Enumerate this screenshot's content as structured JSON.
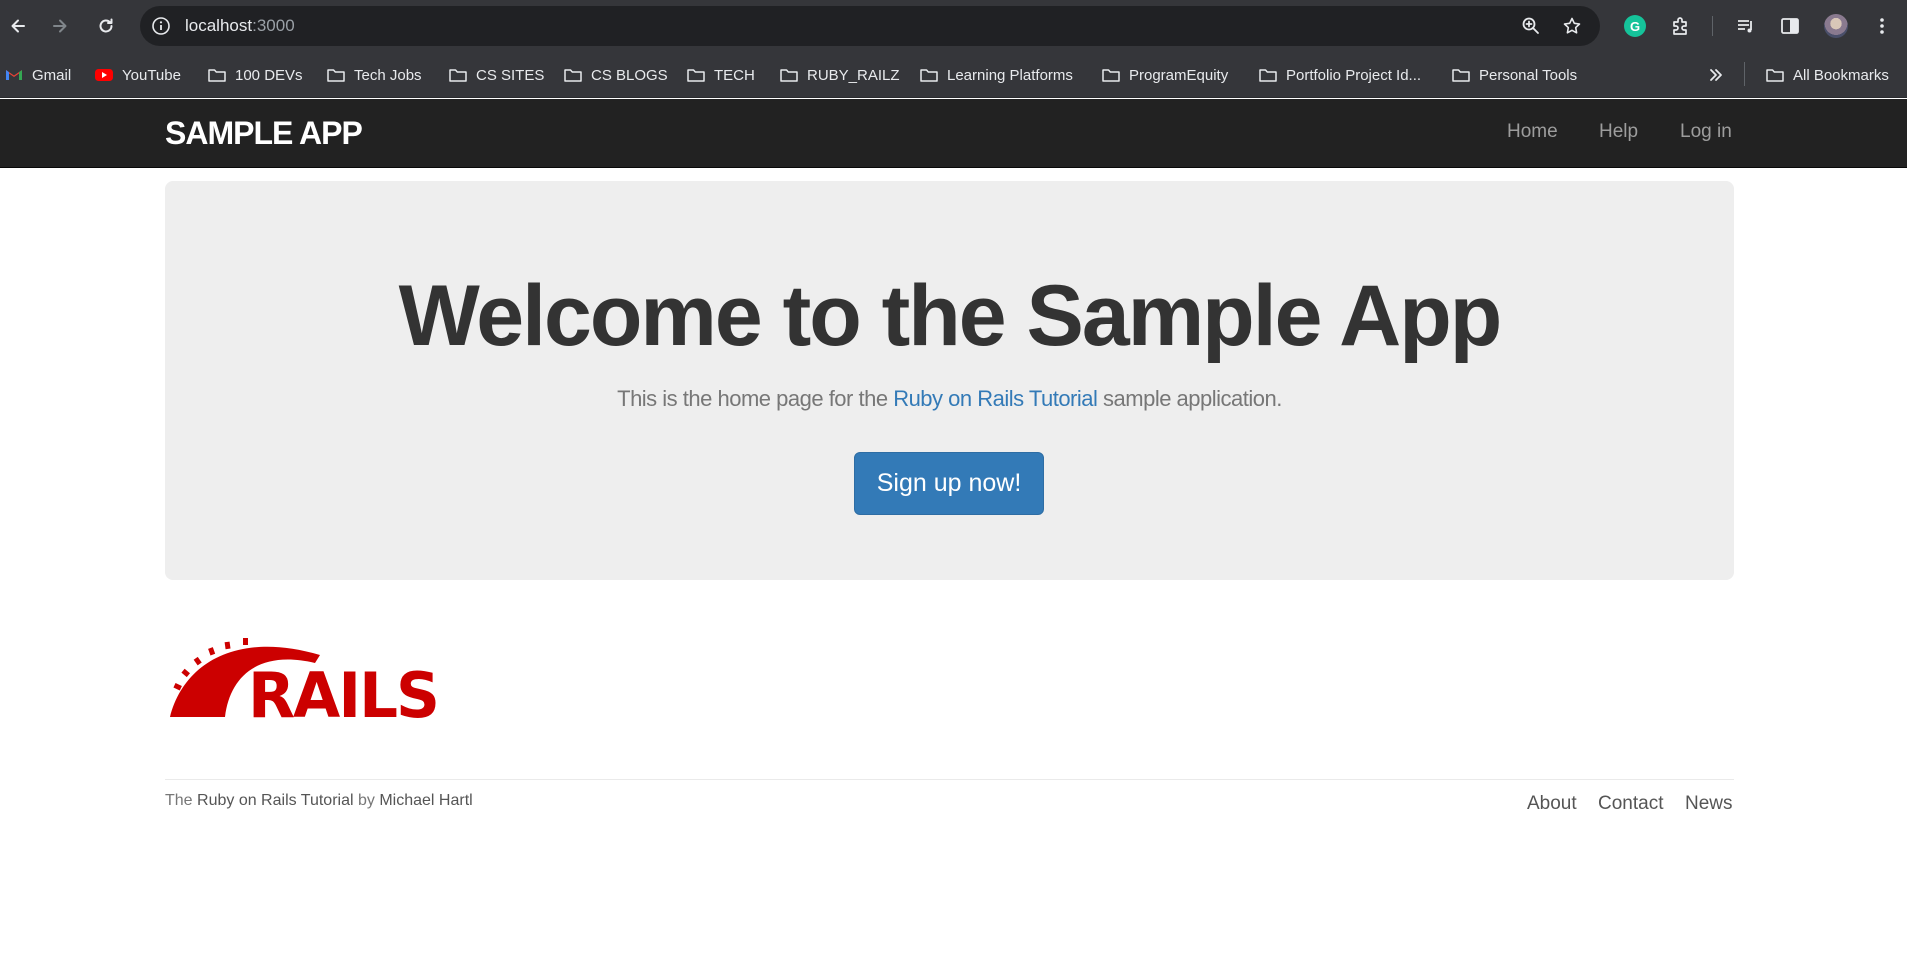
{
  "browser": {
    "url_host": "localhost",
    "url_port": ":3000",
    "grammarly_letter": "G",
    "bookmarks": [
      {
        "label": "Gmail",
        "icon": "gmail-icon"
      },
      {
        "label": "YouTube",
        "icon": "youtube-icon"
      },
      {
        "label": "100 DEVs",
        "icon": "folder-icon"
      },
      {
        "label": "Tech Jobs",
        "icon": "folder-icon"
      },
      {
        "label": "CS SITES",
        "icon": "folder-icon"
      },
      {
        "label": "CS BLOGS",
        "icon": "folder-icon"
      },
      {
        "label": "TECH",
        "icon": "folder-icon"
      },
      {
        "label": "RUBY_RAILZ",
        "icon": "folder-icon"
      },
      {
        "label": "Learning Platforms",
        "icon": "folder-icon"
      },
      {
        "label": "ProgramEquity",
        "icon": "folder-icon"
      },
      {
        "label": "Portfolio Project Id...",
        "icon": "folder-icon"
      },
      {
        "label": "Personal Tools",
        "icon": "folder-icon"
      }
    ],
    "all_bookmarks_label": "All Bookmarks"
  },
  "navbar": {
    "logo": "SAMPLE APP",
    "links": [
      {
        "label": "Home"
      },
      {
        "label": "Help"
      },
      {
        "label": "Log in"
      }
    ]
  },
  "hero": {
    "title": "Welcome to the Sample App",
    "subtitle_before": "This is the home page for the ",
    "subtitle_link": "Ruby on Rails Tutorial",
    "subtitle_after": " sample application.",
    "button_label": "Sign up now!"
  },
  "logo_image": {
    "text": "RAILS",
    "color": "#cc0000"
  },
  "footer": {
    "prefix": "The ",
    "tutorial_link": "Ruby on Rails Tutorial",
    "by": " by ",
    "author_link": "Michael Hartl",
    "links": [
      {
        "label": "About"
      },
      {
        "label": "Contact"
      },
      {
        "label": "News"
      }
    ]
  },
  "colors": {
    "navbar_bg": "#222222",
    "link_blue": "#337ab7",
    "jumbotron_bg": "#eeeeee",
    "rails_red": "#cc0000"
  }
}
